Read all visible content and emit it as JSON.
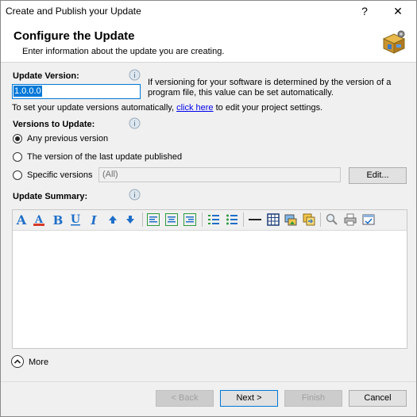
{
  "window": {
    "title": "Create and Publish your Update",
    "help_label": "?",
    "close_label": "✕"
  },
  "header": {
    "title": "Configure the Update",
    "subtitle": "Enter information about the update you are creating."
  },
  "update_version": {
    "label": "Update Version:",
    "value": "1.0.0.0",
    "help_text": "If versioning for your software is determined by the version of a program file, this value can be set automatically.",
    "auto_prefix": "To set your update versions automatically,",
    "auto_link": "click here",
    "auto_suffix": "to edit your project settings."
  },
  "versions_to_update": {
    "label": "Versions to Update:",
    "options": [
      {
        "label": "Any previous version",
        "checked": true
      },
      {
        "label": "The version of the last update published",
        "checked": false
      },
      {
        "label": "Specific versions",
        "checked": false
      }
    ],
    "specific_value": "(All)",
    "edit_button": "Edit..."
  },
  "summary": {
    "label": "Update Summary:",
    "toolbar_icons": [
      "font-icon",
      "font-color-icon",
      "bold-icon",
      "underline-icon",
      "italic-icon",
      "increase-size-icon",
      "decrease-size-icon",
      "align-left-icon",
      "align-center-icon",
      "align-right-icon",
      "numbered-list-icon",
      "bullet-list-icon",
      "horizontal-rule-icon",
      "table-icon",
      "insert-image-icon",
      "insert-link-icon",
      "find-icon",
      "print-icon",
      "spellcheck-icon"
    ],
    "content": ""
  },
  "more": {
    "label": "More",
    "icon": "chevron-up-icon"
  },
  "footer": {
    "back": "< Back",
    "next": "Next >",
    "finish": "Finish",
    "cancel": "Cancel"
  },
  "colors": {
    "accent": "#0078d7",
    "link": "#0000ee",
    "toolbar_blue": "#1e6fc8",
    "toolbar_green": "#2e9a3e"
  }
}
